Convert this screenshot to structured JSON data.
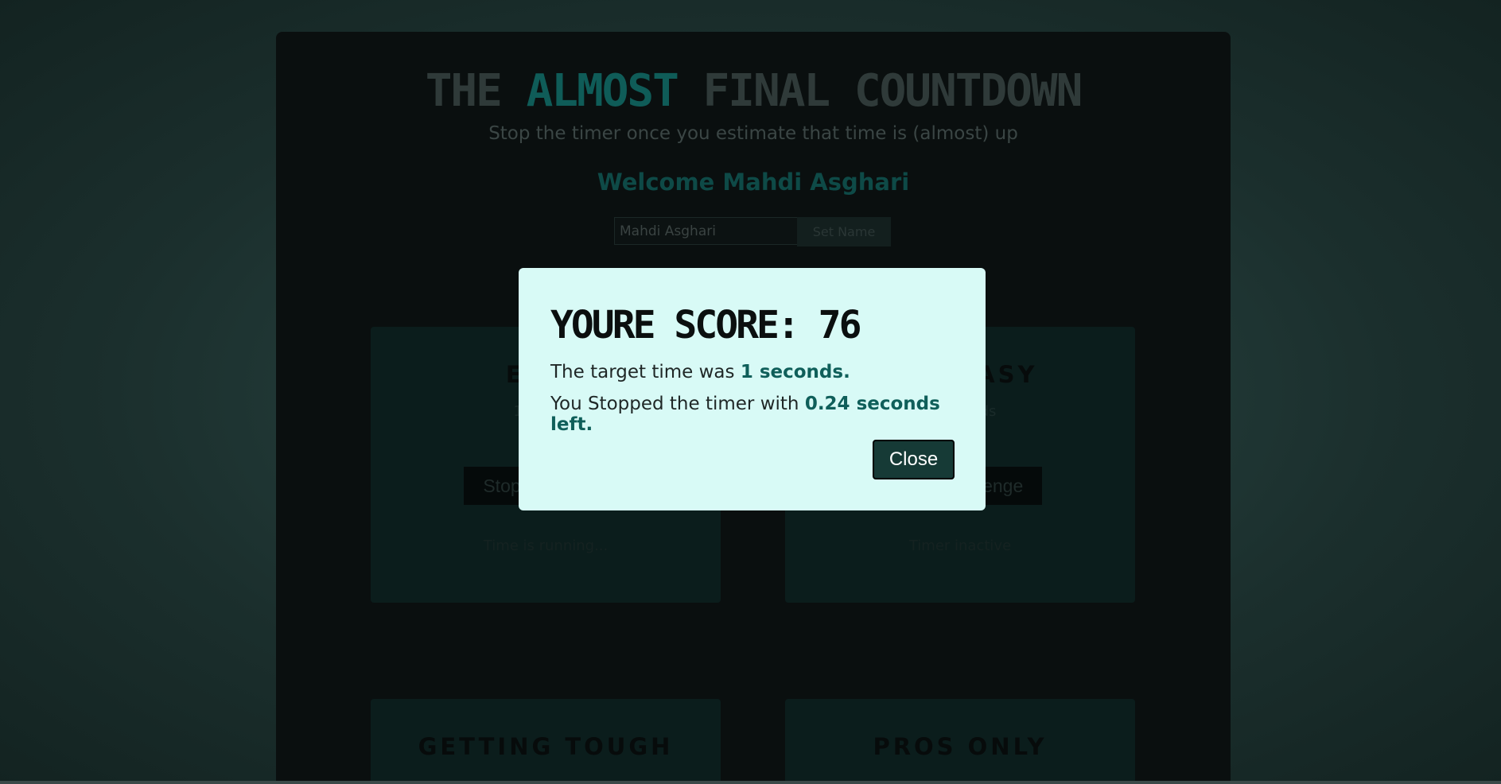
{
  "app": {
    "title_pre": "THE ",
    "title_hl": "ALMOST",
    "title_post": " FINAL COUNTDOWN",
    "subtitle": "Stop the timer once you estimate that time is (almost) up",
    "welcome": "Welcome Mahdi Asghari"
  },
  "name_form": {
    "input_value": "Mahdi Asghari",
    "button_label": "Set Name"
  },
  "cards": [
    {
      "title": "EASY",
      "subtitle": "1 second",
      "button": "Stop Challenge",
      "status": "Time is running..."
    },
    {
      "title": "NOT EASY",
      "subtitle": "5 seconds",
      "button": "Start Challenge",
      "status": "Timer inactive"
    },
    {
      "title": "GETTING TOUGH",
      "subtitle": "",
      "button": "",
      "status": ""
    },
    {
      "title": "PROS ONLY",
      "subtitle": "",
      "button": "",
      "status": ""
    }
  ],
  "modal": {
    "title": "YOURE SCORE: 76",
    "line1_prefix": "The target time was ",
    "line1_value": "1 seconds.",
    "line2_prefix": "You Stopped the timer with ",
    "line2_value": "0.24 seconds left.",
    "close_label": "Close"
  }
}
